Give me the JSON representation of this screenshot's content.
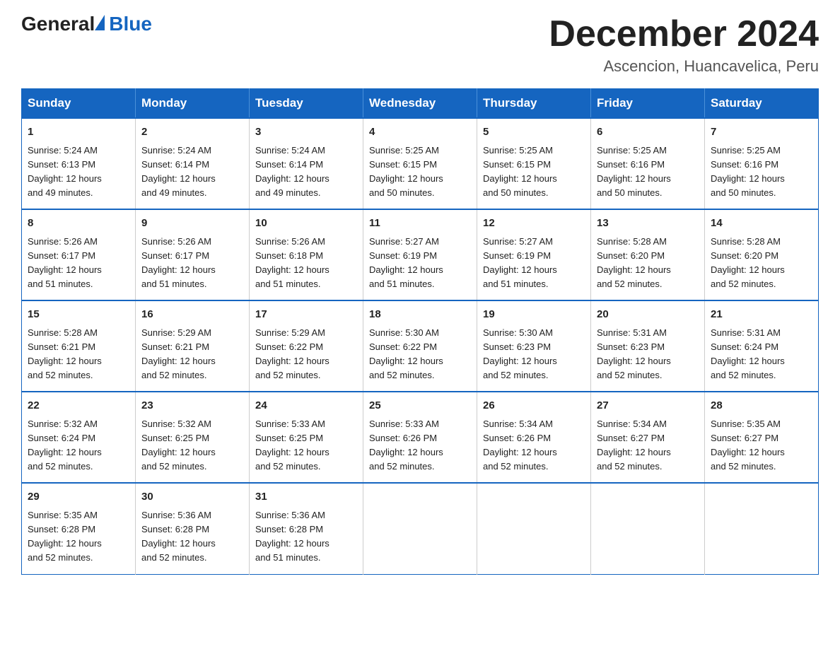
{
  "logo": {
    "general": "General",
    "triangle_char": "",
    "blue": "Blue"
  },
  "title": "December 2024",
  "subtitle": "Ascencion, Huancavelica, Peru",
  "header_days": [
    "Sunday",
    "Monday",
    "Tuesday",
    "Wednesday",
    "Thursday",
    "Friday",
    "Saturday"
  ],
  "weeks": [
    [
      {
        "day": "1",
        "info": "Sunrise: 5:24 AM\nSunset: 6:13 PM\nDaylight: 12 hours\nand 49 minutes."
      },
      {
        "day": "2",
        "info": "Sunrise: 5:24 AM\nSunset: 6:14 PM\nDaylight: 12 hours\nand 49 minutes."
      },
      {
        "day": "3",
        "info": "Sunrise: 5:24 AM\nSunset: 6:14 PM\nDaylight: 12 hours\nand 49 minutes."
      },
      {
        "day": "4",
        "info": "Sunrise: 5:25 AM\nSunset: 6:15 PM\nDaylight: 12 hours\nand 50 minutes."
      },
      {
        "day": "5",
        "info": "Sunrise: 5:25 AM\nSunset: 6:15 PM\nDaylight: 12 hours\nand 50 minutes."
      },
      {
        "day": "6",
        "info": "Sunrise: 5:25 AM\nSunset: 6:16 PM\nDaylight: 12 hours\nand 50 minutes."
      },
      {
        "day": "7",
        "info": "Sunrise: 5:25 AM\nSunset: 6:16 PM\nDaylight: 12 hours\nand 50 minutes."
      }
    ],
    [
      {
        "day": "8",
        "info": "Sunrise: 5:26 AM\nSunset: 6:17 PM\nDaylight: 12 hours\nand 51 minutes."
      },
      {
        "day": "9",
        "info": "Sunrise: 5:26 AM\nSunset: 6:17 PM\nDaylight: 12 hours\nand 51 minutes."
      },
      {
        "day": "10",
        "info": "Sunrise: 5:26 AM\nSunset: 6:18 PM\nDaylight: 12 hours\nand 51 minutes."
      },
      {
        "day": "11",
        "info": "Sunrise: 5:27 AM\nSunset: 6:19 PM\nDaylight: 12 hours\nand 51 minutes."
      },
      {
        "day": "12",
        "info": "Sunrise: 5:27 AM\nSunset: 6:19 PM\nDaylight: 12 hours\nand 51 minutes."
      },
      {
        "day": "13",
        "info": "Sunrise: 5:28 AM\nSunset: 6:20 PM\nDaylight: 12 hours\nand 52 minutes."
      },
      {
        "day": "14",
        "info": "Sunrise: 5:28 AM\nSunset: 6:20 PM\nDaylight: 12 hours\nand 52 minutes."
      }
    ],
    [
      {
        "day": "15",
        "info": "Sunrise: 5:28 AM\nSunset: 6:21 PM\nDaylight: 12 hours\nand 52 minutes."
      },
      {
        "day": "16",
        "info": "Sunrise: 5:29 AM\nSunset: 6:21 PM\nDaylight: 12 hours\nand 52 minutes."
      },
      {
        "day": "17",
        "info": "Sunrise: 5:29 AM\nSunset: 6:22 PM\nDaylight: 12 hours\nand 52 minutes."
      },
      {
        "day": "18",
        "info": "Sunrise: 5:30 AM\nSunset: 6:22 PM\nDaylight: 12 hours\nand 52 minutes."
      },
      {
        "day": "19",
        "info": "Sunrise: 5:30 AM\nSunset: 6:23 PM\nDaylight: 12 hours\nand 52 minutes."
      },
      {
        "day": "20",
        "info": "Sunrise: 5:31 AM\nSunset: 6:23 PM\nDaylight: 12 hours\nand 52 minutes."
      },
      {
        "day": "21",
        "info": "Sunrise: 5:31 AM\nSunset: 6:24 PM\nDaylight: 12 hours\nand 52 minutes."
      }
    ],
    [
      {
        "day": "22",
        "info": "Sunrise: 5:32 AM\nSunset: 6:24 PM\nDaylight: 12 hours\nand 52 minutes."
      },
      {
        "day": "23",
        "info": "Sunrise: 5:32 AM\nSunset: 6:25 PM\nDaylight: 12 hours\nand 52 minutes."
      },
      {
        "day": "24",
        "info": "Sunrise: 5:33 AM\nSunset: 6:25 PM\nDaylight: 12 hours\nand 52 minutes."
      },
      {
        "day": "25",
        "info": "Sunrise: 5:33 AM\nSunset: 6:26 PM\nDaylight: 12 hours\nand 52 minutes."
      },
      {
        "day": "26",
        "info": "Sunrise: 5:34 AM\nSunset: 6:26 PM\nDaylight: 12 hours\nand 52 minutes."
      },
      {
        "day": "27",
        "info": "Sunrise: 5:34 AM\nSunset: 6:27 PM\nDaylight: 12 hours\nand 52 minutes."
      },
      {
        "day": "28",
        "info": "Sunrise: 5:35 AM\nSunset: 6:27 PM\nDaylight: 12 hours\nand 52 minutes."
      }
    ],
    [
      {
        "day": "29",
        "info": "Sunrise: 5:35 AM\nSunset: 6:28 PM\nDaylight: 12 hours\nand 52 minutes."
      },
      {
        "day": "30",
        "info": "Sunrise: 5:36 AM\nSunset: 6:28 PM\nDaylight: 12 hours\nand 52 minutes."
      },
      {
        "day": "31",
        "info": "Sunrise: 5:36 AM\nSunset: 6:28 PM\nDaylight: 12 hours\nand 51 minutes."
      },
      {
        "day": "",
        "info": ""
      },
      {
        "day": "",
        "info": ""
      },
      {
        "day": "",
        "info": ""
      },
      {
        "day": "",
        "info": ""
      }
    ]
  ]
}
